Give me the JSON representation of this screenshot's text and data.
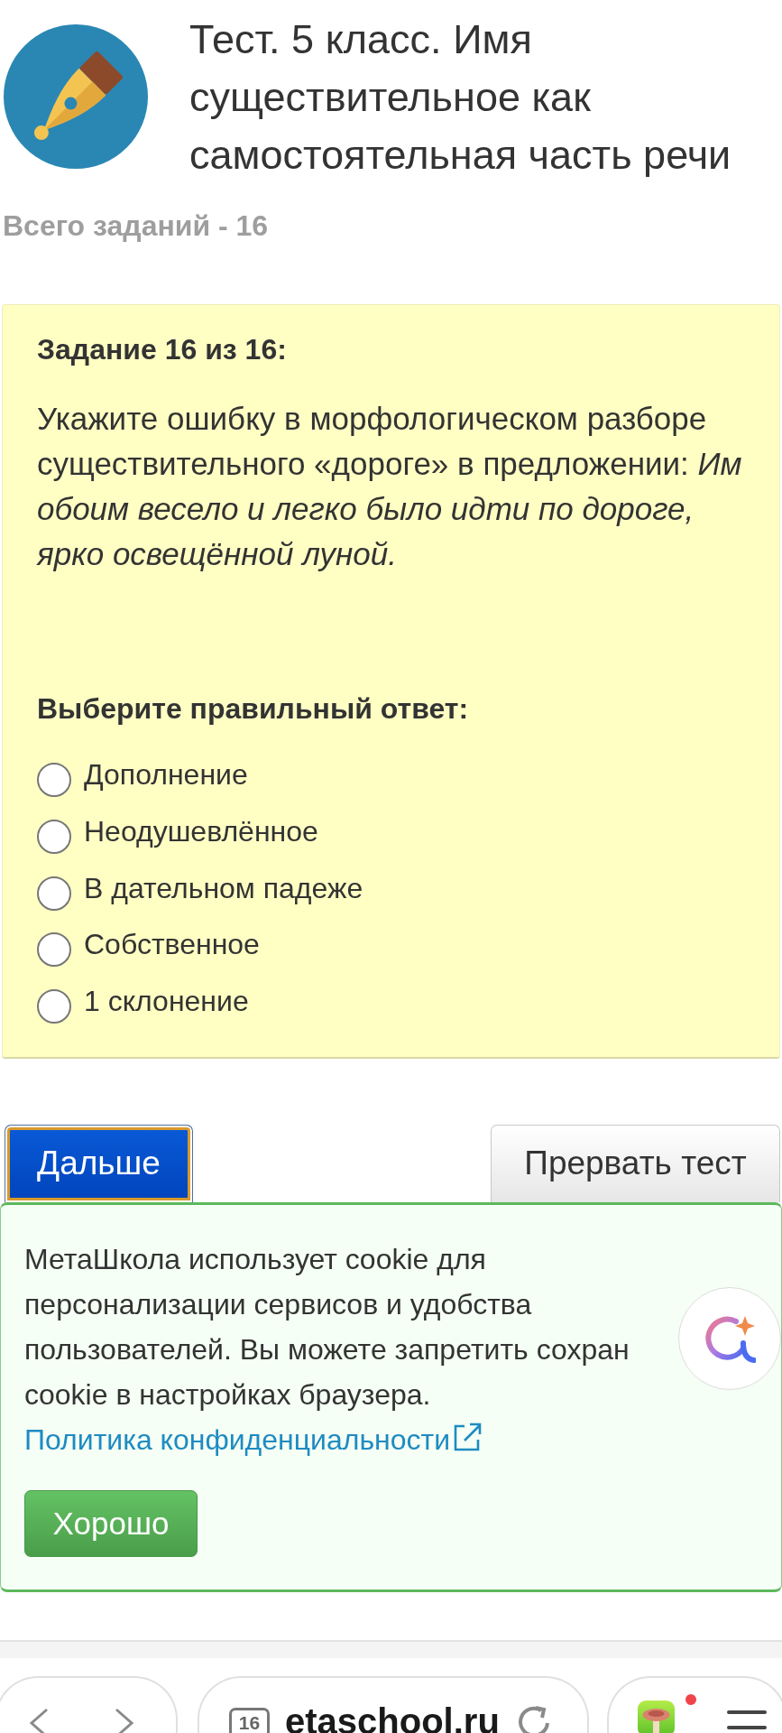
{
  "header": {
    "title": "Тест. 5 класс. Имя существительное как самостоятельная часть речи",
    "total_tasks": "Всего заданий - 16"
  },
  "task": {
    "heading": "Задание 16 из 16:",
    "question": "Укажите ошибку в морфологическом разборе существительного «дороге» в предложении: *Им обоим весело и легко было идти по дороге, ярко освещённой луной.*",
    "prompt": "Выберите правильный ответ:",
    "options": [
      {
        "label": "Дополнение",
        "selected": false
      },
      {
        "label": "Неодушевлённое",
        "selected": false
      },
      {
        "label": "В дательном падеже",
        "selected": false
      },
      {
        "label": "Собственное",
        "selected": false
      },
      {
        "label": "1 склонение",
        "selected": false
      }
    ]
  },
  "actions": [
    {
      "kind": "primary",
      "label": "Дальше"
    },
    {
      "kind": "secondary",
      "label": "Прервать тест"
    }
  ],
  "cookie_notice": {
    "text": "МетаШкола использует cookie для персонализации сервисов и удобства пользователей. Вы можете запретить сохран cookie в настройках браузера.",
    "link": "Политика конфиденциальности",
    "button": "Хорошо"
  },
  "browser_bar": {
    "tab_count": "16",
    "address": "etaschool.ru"
  }
}
